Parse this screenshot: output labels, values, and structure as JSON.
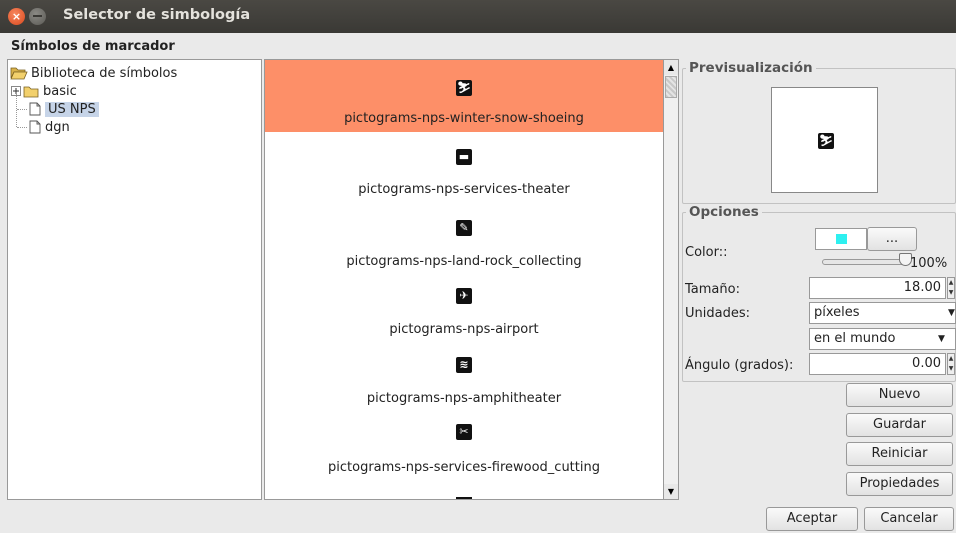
{
  "window": {
    "title": "Selector de simbología"
  },
  "section_header": "Símbolos de marcador",
  "tree": {
    "root": "Biblioteca de símbolos",
    "items": [
      {
        "label": "basic",
        "type": "folder"
      },
      {
        "label": "US NPS",
        "type": "file",
        "selected": true
      },
      {
        "label": "dgn",
        "type": "file"
      }
    ]
  },
  "symbols": [
    {
      "label": "pictograms-nps-winter-snow-shoeing",
      "icon": "snowshoeing-icon",
      "glyph": "⛷",
      "selected": true
    },
    {
      "label": "pictograms-nps-services-theater",
      "icon": "theater-icon",
      "glyph": "▬"
    },
    {
      "label": "pictograms-nps-land-rock_collecting",
      "icon": "rock-collecting-icon",
      "glyph": "✎"
    },
    {
      "label": "pictograms-nps-airport",
      "icon": "airport-icon",
      "glyph": "✈"
    },
    {
      "label": "pictograms-nps-amphitheater",
      "icon": "amphitheater-icon",
      "glyph": "≋"
    },
    {
      "label": "pictograms-nps-services-firewood_cutting",
      "icon": "firewood-cutting-icon",
      "glyph": "✂"
    }
  ],
  "preview": {
    "title": "Previsualización",
    "icon": "snowshoeing-icon",
    "glyph": "⛷"
  },
  "options": {
    "title": "Opciones",
    "color_label": "Color::",
    "color_value": "#2ef0f0",
    "color_button": "...",
    "opacity": "100%",
    "size_label": "Tamaño:",
    "size_value": "18.00",
    "units_label": "Unidades:",
    "units_value": "píxeles",
    "units_ref_value": "en el mundo",
    "angle_label": "Ángulo (grados):",
    "angle_value": "0.00"
  },
  "buttons": {
    "nuevo": "Nuevo",
    "guardar": "Guardar",
    "reiniciar": "Reiniciar",
    "propiedades": "Propiedades",
    "aceptar": "Aceptar",
    "cancelar": "Cancelar"
  }
}
